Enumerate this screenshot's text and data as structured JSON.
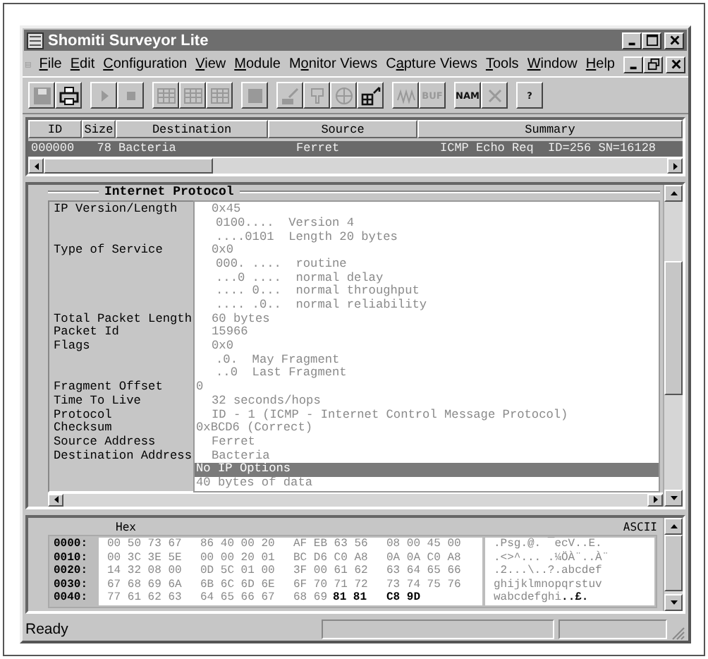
{
  "window": {
    "title": "Shomiti Surveyor Lite"
  },
  "menu": [
    {
      "key": "F",
      "post": "ile"
    },
    {
      "key": "E",
      "post": "dit"
    },
    {
      "key": "C",
      "post": "onfiguration"
    },
    {
      "key": "V",
      "post": "iew"
    },
    {
      "key": "M",
      "post": "odule"
    },
    {
      "pre": "M",
      "key": "o",
      "post": "nitor Views"
    },
    {
      "pre": "C",
      "key": "a",
      "post": "pture Views"
    },
    {
      "key": "T",
      "post": "ools"
    },
    {
      "key": "W",
      "post": "indow"
    },
    {
      "key": "H",
      "post": "elp"
    }
  ],
  "toolbar": [
    [
      {
        "kind": "save",
        "disabled": true
      },
      {
        "kind": "print",
        "disabled": false
      }
    ],
    [
      {
        "kind": "play",
        "disabled": true
      },
      {
        "kind": "stop",
        "disabled": true
      }
    ],
    [
      {
        "kind": "grid",
        "disabled": true
      },
      {
        "kind": "grid",
        "disabled": true
      },
      {
        "kind": "grid",
        "disabled": true
      }
    ],
    [
      {
        "kind": "square",
        "disabled": true
      }
    ],
    [
      {
        "kind": "pen",
        "disabled": true
      },
      {
        "kind": "doc",
        "disabled": true
      },
      {
        "kind": "globe",
        "disabled": true
      },
      {
        "kind": "network",
        "disabled": false
      }
    ],
    [
      {
        "kind": "wave",
        "disabled": true
      },
      {
        "kind": "text",
        "label": "BUF",
        "disabled": true
      }
    ],
    [
      {
        "kind": "text",
        "label": "NAM",
        "disabled": false
      },
      {
        "kind": "cross",
        "disabled": true
      }
    ],
    [
      {
        "kind": "text",
        "label": "?",
        "disabled": false
      }
    ]
  ],
  "packet_list": {
    "columns": [
      "ID",
      "Size",
      "Destination",
      "Source",
      "Summary"
    ],
    "rows": [
      {
        "id": "000000",
        "size": "78",
        "destination": "Bacteria",
        "source": "Ferret",
        "summary": "ICMP Echo Req  ID=256 SN=16128",
        "selected": true
      }
    ]
  },
  "detail": {
    "title": "Internet Protocol",
    "rows": [
      {
        "label": "IP Version/Length",
        "value": "0x45",
        "kind": "value",
        "selected": false
      },
      {
        "value": "0100....  Version 4",
        "kind": "bits",
        "selected": false
      },
      {
        "value": "....0101  Length 20 bytes",
        "kind": "bits",
        "selected": false
      },
      {
        "label": "Type of Service",
        "value": "0x0",
        "kind": "value",
        "selected": false
      },
      {
        "value": "000. ....  routine",
        "kind": "bits",
        "selected": false
      },
      {
        "value": "...0 ....  normal delay",
        "kind": "bits",
        "selected": false
      },
      {
        "value": ".... 0...  normal throughput",
        "kind": "bits",
        "selected": false
      },
      {
        "value": ".... .0..  normal reliability",
        "kind": "bits",
        "selected": false
      },
      {
        "label": "Total Packet Length",
        "value": "60 bytes",
        "kind": "value",
        "selected": false
      },
      {
        "label": "Packet Id",
        "value": "15966",
        "kind": "value",
        "selected": false
      },
      {
        "label": "Flags",
        "value": "0x0",
        "kind": "value",
        "selected": false
      },
      {
        "value": ".0.  May Fragment",
        "kind": "bits",
        "selected": false
      },
      {
        "value": "..0  Last Fragment",
        "kind": "bits",
        "selected": false
      },
      {
        "label": "Fragment Offset",
        "value": "0",
        "kind": "flush",
        "selected": false
      },
      {
        "label": "Time To Live",
        "value": "32 seconds/hops",
        "kind": "value",
        "selected": false
      },
      {
        "label": "Protocol",
        "value": "ID - 1 (ICMP - Internet Control Message Protocol)",
        "kind": "value",
        "selected": false
      },
      {
        "label": "Checksum",
        "value": "0xBCD6 (Correct)",
        "kind": "flush",
        "selected": false
      },
      {
        "label": "Source Address",
        "value": "Ferret",
        "kind": "value",
        "selected": false
      },
      {
        "label": "Destination Address",
        "value": "Bacteria",
        "kind": "value",
        "selected": false
      },
      {
        "value": "No IP Options",
        "kind": "flush",
        "selected": true
      },
      {
        "value": "40 bytes of data",
        "kind": "flush",
        "selected": false
      }
    ]
  },
  "hex": {
    "hex_label": "Hex",
    "ascii_label": "ASCII",
    "rows": [
      {
        "offset": "0000:",
        "groups": [
          [
            {
              "text": "00 50 73 67",
              "highlighted": false
            }
          ],
          [
            {
              "text": "86 40 00 20",
              "highlighted": false
            }
          ],
          [
            {
              "text": "AF EB 63 56",
              "highlighted": false
            }
          ],
          [
            {
              "text": "08 00 45 00",
              "highlighted": false
            }
          ]
        ],
        "ascii": [
          {
            "text": ".Psg.@. ¯ecV..E.",
            "highlighted": false
          }
        ]
      },
      {
        "offset": "0010:",
        "groups": [
          [
            {
              "text": "00 3C 3E 5E",
              "highlighted": false
            }
          ],
          [
            {
              "text": "00 00 20 01",
              "highlighted": false
            }
          ],
          [
            {
              "text": "BC D6 C0 A8",
              "highlighted": false
            }
          ],
          [
            {
              "text": "0A 0A C0 A8",
              "highlighted": false
            }
          ]
        ],
        "ascii": [
          {
            "text": ".<>^... .¼ÖÀ¨..À¨",
            "highlighted": false
          }
        ]
      },
      {
        "offset": "0020:",
        "groups": [
          [
            {
              "text": "14 32 08 00",
              "highlighted": false
            }
          ],
          [
            {
              "text": "0D 5C 01 00",
              "highlighted": false
            }
          ],
          [
            {
              "text": "3F 00 61 62",
              "highlighted": false
            }
          ],
          [
            {
              "text": "63 64 65 66",
              "highlighted": false
            }
          ]
        ],
        "ascii": [
          {
            "text": ".2...\\..?.abcdef",
            "highlighted": false
          }
        ]
      },
      {
        "offset": "0030:",
        "groups": [
          [
            {
              "text": "67 68 69 6A",
              "highlighted": false
            }
          ],
          [
            {
              "text": "6B 6C 6D 6E",
              "highlighted": false
            }
          ],
          [
            {
              "text": "6F 70 71 72",
              "highlighted": false
            }
          ],
          [
            {
              "text": "73 74 75 76",
              "highlighted": false
            }
          ]
        ],
        "ascii": [
          {
            "text": "ghijklmnopqrstuv",
            "highlighted": false
          }
        ]
      },
      {
        "offset": "0040:",
        "groups": [
          [
            {
              "text": "77 61 62 63",
              "highlighted": false
            }
          ],
          [
            {
              "text": "64 65 66 67",
              "highlighted": false
            }
          ],
          [
            {
              "text": "68 69",
              "highlighted": false
            },
            {
              "text": "81 81",
              "highlighted": true
            }
          ],
          [
            {
              "text": "C8 9D",
              "highlighted": true
            }
          ]
        ],
        "ascii": [
          {
            "text": "wabcdefghi",
            "highlighted": false
          },
          {
            "text": "..£.",
            "highlighted": true
          }
        ]
      }
    ]
  },
  "status_bar": {
    "text": "Ready"
  }
}
